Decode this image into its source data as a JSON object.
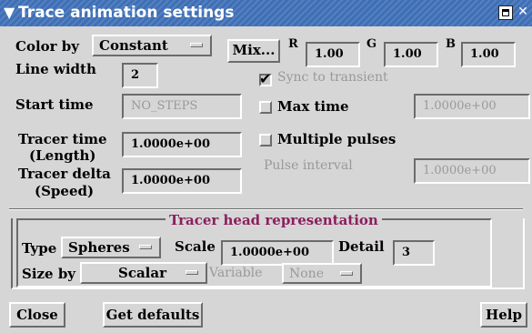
{
  "window": {
    "title": "Trace animation settings"
  },
  "color": {
    "label": "Color by",
    "mode": "Constant",
    "mix_label": "Mix...",
    "r_label": "R",
    "r_value": "1.00",
    "g_label": "G",
    "g_value": "1.00",
    "b_label": "B",
    "b_value": "1.00"
  },
  "line_width": {
    "label": "Line width",
    "value": "2"
  },
  "sync": {
    "label": "Sync to transient",
    "checked": true,
    "enabled": false
  },
  "start_time": {
    "label": "Start time",
    "value": "NO_STEPS"
  },
  "max_time": {
    "label": "Max time",
    "checked": false,
    "value": "1.0000e+00"
  },
  "tracer_time": {
    "label": "Tracer time",
    "sublabel": "(Length)",
    "value": "1.0000e+00"
  },
  "multiple_pulses": {
    "label": "Multiple pulses",
    "checked": false
  },
  "pulse_interval": {
    "label": "Pulse interval",
    "value": "1.0000e+00"
  },
  "tracer_delta": {
    "label": "Tracer delta",
    "sublabel": "(Speed)",
    "value": "1.0000e+00"
  },
  "head": {
    "title": "Tracer head representation",
    "type_label": "Type",
    "type_value": "Spheres",
    "scale_label": "Scale",
    "scale_value": "1.0000e+00",
    "detail_label": "Detail",
    "detail_value": "3",
    "size_by_label": "Size by",
    "size_by_value": "Scalar",
    "variable_label": "Variable",
    "variable_value": "None"
  },
  "buttons": {
    "close": "Close",
    "get_defaults": "Get defaults",
    "help": "Help"
  },
  "colors": {
    "titlebar": "#3e6fb6",
    "background": "#d6d6d6",
    "group_title": "#8b1f5f",
    "check": "#000000"
  }
}
